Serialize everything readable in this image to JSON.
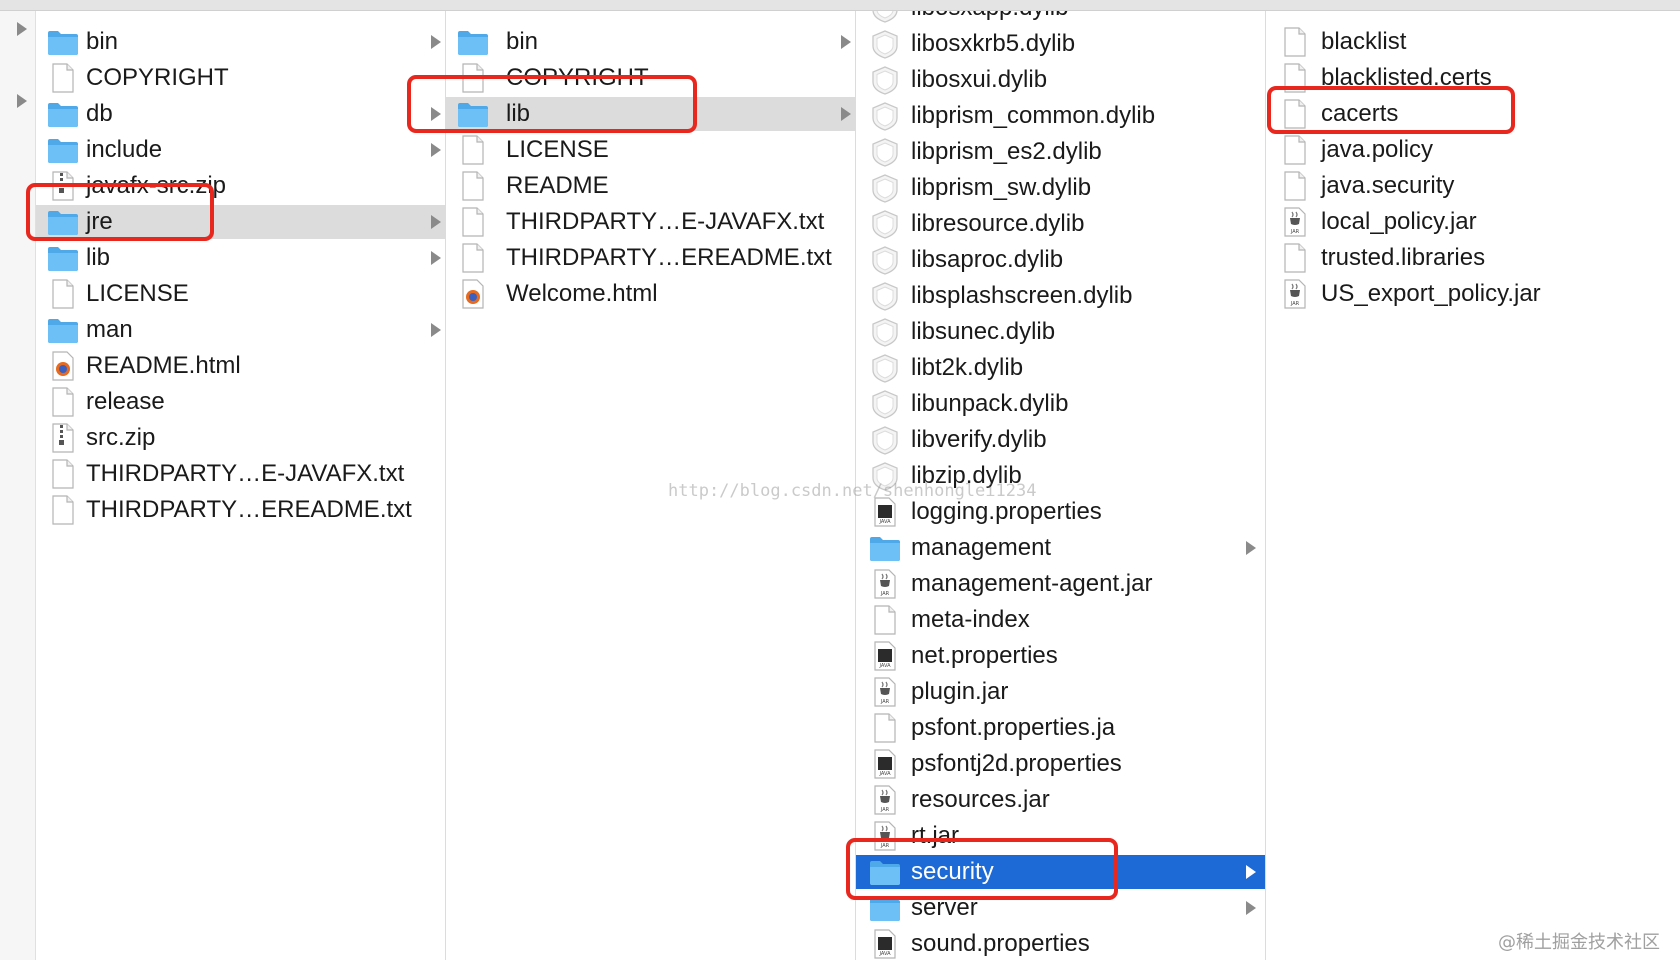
{
  "columns": [
    {
      "items": [
        {
          "label": "bin",
          "icon": "folder",
          "arrow": true
        },
        {
          "label": "COPYRIGHT",
          "icon": "file",
          "arrow": false
        },
        {
          "label": "db",
          "icon": "folder",
          "arrow": true
        },
        {
          "label": "include",
          "icon": "folder",
          "arrow": true
        },
        {
          "label": "javafx-src.zip",
          "icon": "zip",
          "arrow": false
        },
        {
          "label": "jre",
          "icon": "folder",
          "arrow": true,
          "selected": "gray"
        },
        {
          "label": "lib",
          "icon": "folder",
          "arrow": true
        },
        {
          "label": "LICENSE",
          "icon": "file",
          "arrow": false
        },
        {
          "label": "man",
          "icon": "folder",
          "arrow": true
        },
        {
          "label": "README.html",
          "icon": "html",
          "arrow": false
        },
        {
          "label": "release",
          "icon": "file",
          "arrow": false
        },
        {
          "label": "src.zip",
          "icon": "zip",
          "arrow": false
        },
        {
          "label": "THIRDPARTY…E-JAVAFX.txt",
          "icon": "file",
          "arrow": false
        },
        {
          "label": "THIRDPARTY…EREADME.txt",
          "icon": "file",
          "arrow": false
        }
      ]
    },
    {
      "items": [
        {
          "label": "bin",
          "icon": "folder",
          "arrow": true
        },
        {
          "label": "COPYRIGHT",
          "icon": "file",
          "arrow": false
        },
        {
          "label": "lib",
          "icon": "folder",
          "arrow": true,
          "selected": "gray"
        },
        {
          "label": "LICENSE",
          "icon": "file",
          "arrow": false
        },
        {
          "label": "README",
          "icon": "file",
          "arrow": false
        },
        {
          "label": "THIRDPARTY…E-JAVAFX.txt",
          "icon": "file",
          "arrow": false
        },
        {
          "label": "THIRDPARTY…EREADME.txt",
          "icon": "file",
          "arrow": false
        },
        {
          "label": "Welcome.html",
          "icon": "html",
          "arrow": false
        }
      ]
    },
    {
      "items": [
        {
          "label": "libosxapp.dylib",
          "icon": "dylib",
          "arrow": false
        },
        {
          "label": "libosxkrb5.dylib",
          "icon": "dylib",
          "arrow": false
        },
        {
          "label": "libosxui.dylib",
          "icon": "dylib",
          "arrow": false
        },
        {
          "label": "libprism_common.dylib",
          "icon": "dylib",
          "arrow": false
        },
        {
          "label": "libprism_es2.dylib",
          "icon": "dylib",
          "arrow": false
        },
        {
          "label": "libprism_sw.dylib",
          "icon": "dylib",
          "arrow": false
        },
        {
          "label": "libresource.dylib",
          "icon": "dylib",
          "arrow": false
        },
        {
          "label": "libsaproc.dylib",
          "icon": "dylib",
          "arrow": false
        },
        {
          "label": "libsplashscreen.dylib",
          "icon": "dylib",
          "arrow": false
        },
        {
          "label": "libsunec.dylib",
          "icon": "dylib",
          "arrow": false
        },
        {
          "label": "libt2k.dylib",
          "icon": "dylib",
          "arrow": false
        },
        {
          "label": "libunpack.dylib",
          "icon": "dylib",
          "arrow": false
        },
        {
          "label": "libverify.dylib",
          "icon": "dylib",
          "arrow": false
        },
        {
          "label": "libzip.dylib",
          "icon": "dylib",
          "arrow": false
        },
        {
          "label": "logging.properties",
          "icon": "javafile",
          "arrow": false
        },
        {
          "label": "management",
          "icon": "folder",
          "arrow": true
        },
        {
          "label": "management-agent.jar",
          "icon": "jar",
          "arrow": false
        },
        {
          "label": "meta-index",
          "icon": "file",
          "arrow": false
        },
        {
          "label": "net.properties",
          "icon": "javafile",
          "arrow": false
        },
        {
          "label": "plugin.jar",
          "icon": "jar",
          "arrow": false
        },
        {
          "label": "psfont.properties.ja",
          "icon": "file",
          "arrow": false
        },
        {
          "label": "psfontj2d.properties",
          "icon": "javafile",
          "arrow": false
        },
        {
          "label": "resources.jar",
          "icon": "jar",
          "arrow": false
        },
        {
          "label": "rt.jar",
          "icon": "jar",
          "arrow": false
        },
        {
          "label": "security",
          "icon": "folder",
          "arrow": true,
          "selected": "blue"
        },
        {
          "label": "server",
          "icon": "folder",
          "arrow": true
        },
        {
          "label": "sound.properties",
          "icon": "javafile",
          "arrow": false
        }
      ]
    },
    {
      "items": [
        {
          "label": "blacklist",
          "icon": "file",
          "arrow": false
        },
        {
          "label": "blacklisted.certs",
          "icon": "file",
          "arrow": false
        },
        {
          "label": "cacerts",
          "icon": "file",
          "arrow": false
        },
        {
          "label": "java.policy",
          "icon": "file",
          "arrow": false
        },
        {
          "label": "java.security",
          "icon": "file",
          "arrow": false
        },
        {
          "label": "local_policy.jar",
          "icon": "jar",
          "arrow": false
        },
        {
          "label": "trusted.libraries",
          "icon": "file",
          "arrow": false
        },
        {
          "label": "US_export_policy.jar",
          "icon": "jar",
          "arrow": false
        }
      ]
    }
  ],
  "sidebar_strip_arrows": 2,
  "watermark": "http://blog.csdn.net/shenhonglei1234",
  "corner_mark": "@稀土掘金技术社区",
  "colors": {
    "selection_blue": "#1d69d5",
    "selection_gray": "#dcdcdc",
    "highlight_red": "#e8281f",
    "folder_blue": "#5ab6f0"
  }
}
